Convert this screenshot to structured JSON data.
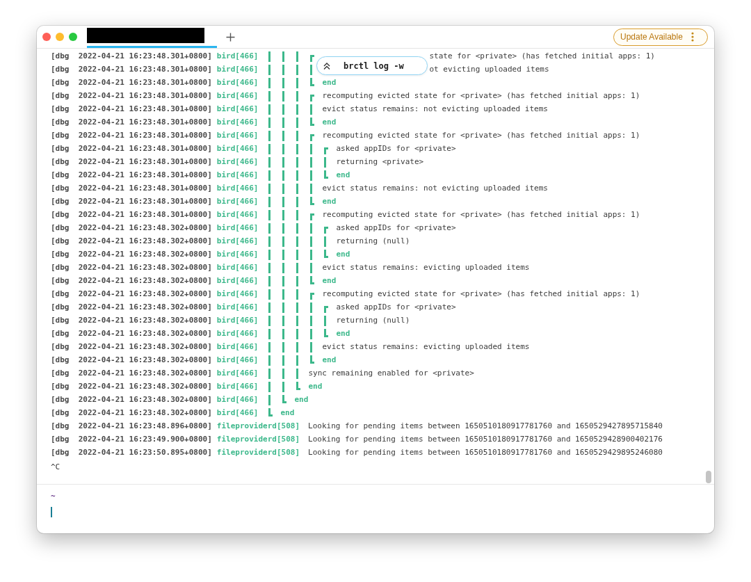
{
  "window": {
    "tabs": [
      {
        "kind": "redacted",
        "selected": true
      }
    ],
    "update_button": {
      "label": "Update Available"
    }
  },
  "command_overlay": {
    "text": "brctl log -w"
  },
  "log_lines": [
    {
      "prefix": "[dbg  2022-04-21 16:23:48.301+0800]",
      "process": "bird[466]",
      "guides": [
        {
          "kind": "bar"
        },
        {
          "kind": "bar"
        },
        {
          "kind": "bar"
        },
        {
          "kind": "open"
        }
      ],
      "kind": "clipped",
      "message": "state for <private> (has fetched initial apps: 1)"
    },
    {
      "prefix": "[dbg  2022-04-21 16:23:48.301+0800]",
      "process": "bird[466]",
      "guides": [
        {
          "kind": "bar"
        },
        {
          "kind": "bar"
        },
        {
          "kind": "bar"
        },
        {
          "kind": "bar"
        }
      ],
      "kind": "clipped",
      "message": "ot evicting uploaded items"
    },
    {
      "prefix": "[dbg  2022-04-21 16:23:48.301+0800]",
      "process": "bird[466]",
      "guides": [
        {
          "kind": "bar"
        },
        {
          "kind": "bar"
        },
        {
          "kind": "bar"
        },
        {
          "kind": "close"
        }
      ],
      "kind": "end",
      "message": "end"
    },
    {
      "prefix": "[dbg  2022-04-21 16:23:48.301+0800]",
      "process": "bird[466]",
      "guides": [
        {
          "kind": "bar"
        },
        {
          "kind": "bar"
        },
        {
          "kind": "bar"
        },
        {
          "kind": "open"
        }
      ],
      "kind": "text",
      "message": "recomputing evicted state for <private> (has fetched initial apps: 1)"
    },
    {
      "prefix": "[dbg  2022-04-21 16:23:48.301+0800]",
      "process": "bird[466]",
      "guides": [
        {
          "kind": "bar"
        },
        {
          "kind": "bar"
        },
        {
          "kind": "bar"
        },
        {
          "kind": "bar"
        }
      ],
      "kind": "text",
      "message": "evict status remains: not evicting uploaded items"
    },
    {
      "prefix": "[dbg  2022-04-21 16:23:48.301+0800]",
      "process": "bird[466]",
      "guides": [
        {
          "kind": "bar"
        },
        {
          "kind": "bar"
        },
        {
          "kind": "bar"
        },
        {
          "kind": "close"
        }
      ],
      "kind": "end",
      "message": "end"
    },
    {
      "prefix": "[dbg  2022-04-21 16:23:48.301+0800]",
      "process": "bird[466]",
      "guides": [
        {
          "kind": "bar"
        },
        {
          "kind": "bar"
        },
        {
          "kind": "bar"
        },
        {
          "kind": "open"
        }
      ],
      "kind": "text",
      "message": "recomputing evicted state for <private> (has fetched initial apps: 1)"
    },
    {
      "prefix": "[dbg  2022-04-21 16:23:48.301+0800]",
      "process": "bird[466]",
      "guides": [
        {
          "kind": "bar"
        },
        {
          "kind": "bar"
        },
        {
          "kind": "bar"
        },
        {
          "kind": "bar"
        },
        {
          "kind": "open"
        }
      ],
      "kind": "text",
      "message": "asked appIDs for <private>"
    },
    {
      "prefix": "[dbg  2022-04-21 16:23:48.301+0800]",
      "process": "bird[466]",
      "guides": [
        {
          "kind": "bar"
        },
        {
          "kind": "bar"
        },
        {
          "kind": "bar"
        },
        {
          "kind": "bar"
        },
        {
          "kind": "bar"
        }
      ],
      "kind": "text",
      "message": "returning <private>"
    },
    {
      "prefix": "[dbg  2022-04-21 16:23:48.301+0800]",
      "process": "bird[466]",
      "guides": [
        {
          "kind": "bar"
        },
        {
          "kind": "bar"
        },
        {
          "kind": "bar"
        },
        {
          "kind": "bar"
        },
        {
          "kind": "close"
        }
      ],
      "kind": "end",
      "message": "end"
    },
    {
      "prefix": "[dbg  2022-04-21 16:23:48.301+0800]",
      "process": "bird[466]",
      "guides": [
        {
          "kind": "bar"
        },
        {
          "kind": "bar"
        },
        {
          "kind": "bar"
        },
        {
          "kind": "bar"
        }
      ],
      "kind": "text",
      "message": "evict status remains: not evicting uploaded items"
    },
    {
      "prefix": "[dbg  2022-04-21 16:23:48.301+0800]",
      "process": "bird[466]",
      "guides": [
        {
          "kind": "bar"
        },
        {
          "kind": "bar"
        },
        {
          "kind": "bar"
        },
        {
          "kind": "close"
        }
      ],
      "kind": "end",
      "message": "end"
    },
    {
      "prefix": "[dbg  2022-04-21 16:23:48.301+0800]",
      "process": "bird[466]",
      "guides": [
        {
          "kind": "bar"
        },
        {
          "kind": "bar"
        },
        {
          "kind": "bar"
        },
        {
          "kind": "open"
        }
      ],
      "kind": "text",
      "message": "recomputing evicted state for <private> (has fetched initial apps: 1)"
    },
    {
      "prefix": "[dbg  2022-04-21 16:23:48.302+0800]",
      "process": "bird[466]",
      "guides": [
        {
          "kind": "bar"
        },
        {
          "kind": "bar"
        },
        {
          "kind": "bar"
        },
        {
          "kind": "bar"
        },
        {
          "kind": "open"
        }
      ],
      "kind": "text",
      "message": "asked appIDs for <private>"
    },
    {
      "prefix": "[dbg  2022-04-21 16:23:48.302+0800]",
      "process": "bird[466]",
      "guides": [
        {
          "kind": "bar"
        },
        {
          "kind": "bar"
        },
        {
          "kind": "bar"
        },
        {
          "kind": "bar"
        },
        {
          "kind": "bar"
        }
      ],
      "kind": "text",
      "message": "returning (null)"
    },
    {
      "prefix": "[dbg  2022-04-21 16:23:48.302+0800]",
      "process": "bird[466]",
      "guides": [
        {
          "kind": "bar"
        },
        {
          "kind": "bar"
        },
        {
          "kind": "bar"
        },
        {
          "kind": "bar"
        },
        {
          "kind": "close"
        }
      ],
      "kind": "end",
      "message": "end"
    },
    {
      "prefix": "[dbg  2022-04-21 16:23:48.302+0800]",
      "process": "bird[466]",
      "guides": [
        {
          "kind": "bar"
        },
        {
          "kind": "bar"
        },
        {
          "kind": "bar"
        },
        {
          "kind": "bar"
        }
      ],
      "kind": "text",
      "message": "evict status remains: evicting uploaded items"
    },
    {
      "prefix": "[dbg  2022-04-21 16:23:48.302+0800]",
      "process": "bird[466]",
      "guides": [
        {
          "kind": "bar"
        },
        {
          "kind": "bar"
        },
        {
          "kind": "bar"
        },
        {
          "kind": "close"
        }
      ],
      "kind": "end",
      "message": "end"
    },
    {
      "prefix": "[dbg  2022-04-21 16:23:48.302+0800]",
      "process": "bird[466]",
      "guides": [
        {
          "kind": "bar"
        },
        {
          "kind": "bar"
        },
        {
          "kind": "bar"
        },
        {
          "kind": "open"
        }
      ],
      "kind": "text",
      "message": "recomputing evicted state for <private> (has fetched initial apps: 1)"
    },
    {
      "prefix": "[dbg  2022-04-21 16:23:48.302+0800]",
      "process": "bird[466]",
      "guides": [
        {
          "kind": "bar"
        },
        {
          "kind": "bar"
        },
        {
          "kind": "bar"
        },
        {
          "kind": "bar"
        },
        {
          "kind": "open"
        }
      ],
      "kind": "text",
      "message": "asked appIDs for <private>"
    },
    {
      "prefix": "[dbg  2022-04-21 16:23:48.302+0800]",
      "process": "bird[466]",
      "guides": [
        {
          "kind": "bar"
        },
        {
          "kind": "bar"
        },
        {
          "kind": "bar"
        },
        {
          "kind": "bar"
        },
        {
          "kind": "bar"
        }
      ],
      "kind": "text",
      "message": "returning (null)"
    },
    {
      "prefix": "[dbg  2022-04-21 16:23:48.302+0800]",
      "process": "bird[466]",
      "guides": [
        {
          "kind": "bar"
        },
        {
          "kind": "bar"
        },
        {
          "kind": "bar"
        },
        {
          "kind": "bar"
        },
        {
          "kind": "close"
        }
      ],
      "kind": "end",
      "message": "end"
    },
    {
      "prefix": "[dbg  2022-04-21 16:23:48.302+0800]",
      "process": "bird[466]",
      "guides": [
        {
          "kind": "bar"
        },
        {
          "kind": "bar"
        },
        {
          "kind": "bar"
        },
        {
          "kind": "bar"
        }
      ],
      "kind": "text",
      "message": "evict status remains: evicting uploaded items"
    },
    {
      "prefix": "[dbg  2022-04-21 16:23:48.302+0800]",
      "process": "bird[466]",
      "guides": [
        {
          "kind": "bar"
        },
        {
          "kind": "bar"
        },
        {
          "kind": "bar"
        },
        {
          "kind": "close"
        }
      ],
      "kind": "end",
      "message": "end"
    },
    {
      "prefix": "[dbg  2022-04-21 16:23:48.302+0800]",
      "process": "bird[466]",
      "guides": [
        {
          "kind": "bar"
        },
        {
          "kind": "bar"
        },
        {
          "kind": "bar"
        }
      ],
      "kind": "text",
      "message": "sync remaining enabled for <private>"
    },
    {
      "prefix": "[dbg  2022-04-21 16:23:48.302+0800]",
      "process": "bird[466]",
      "guides": [
        {
          "kind": "bar"
        },
        {
          "kind": "bar"
        },
        {
          "kind": "close"
        }
      ],
      "kind": "end",
      "message": "end"
    },
    {
      "prefix": "[dbg  2022-04-21 16:23:48.302+0800]",
      "process": "bird[466]",
      "guides": [
        {
          "kind": "bar"
        },
        {
          "kind": "close"
        }
      ],
      "kind": "end",
      "message": "end"
    },
    {
      "prefix": "[dbg  2022-04-21 16:23:48.302+0800]",
      "process": "bird[466]",
      "guides": [
        {
          "kind": "close"
        }
      ],
      "kind": "end",
      "message": "end"
    },
    {
      "prefix": "[dbg  2022-04-21 16:23:48.896+0800]",
      "process": "fileproviderd[508]",
      "kind": "text",
      "message": "Looking for pending items between 1650510180917781760 and 1650529427895715840"
    },
    {
      "prefix": "[dbg  2022-04-21 16:23:49.900+0800]",
      "process": "fileproviderd[508]",
      "kind": "text",
      "message": "Looking for pending items between 1650510180917781760 and 1650529428900402176"
    },
    {
      "prefix": "[dbg  2022-04-21 16:23:50.895+0800]",
      "process": "fileproviderd[508]",
      "kind": "text",
      "message": "Looking for pending items between 1650510180917781760 and 1650529429895246080"
    }
  ],
  "interrupt": "^C",
  "prompt": {
    "directory": "~"
  }
}
